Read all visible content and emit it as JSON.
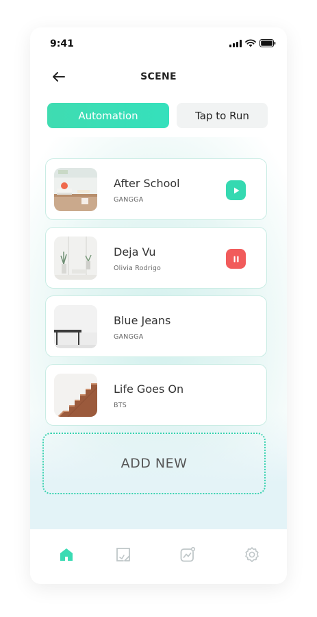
{
  "status_bar": {
    "time": "9:41"
  },
  "header": {
    "title": "SCENE"
  },
  "tabs": [
    {
      "label": "Automation",
      "active": true
    },
    {
      "label": "Tap to Run",
      "active": false
    }
  ],
  "scenes": [
    {
      "title": "After School",
      "subtitle": "GANGGA",
      "action": "play"
    },
    {
      "title": "Deja Vu",
      "subtitle": "Olivia Rodrigo",
      "action": "pause"
    },
    {
      "title": "Blue Jeans",
      "subtitle": "GANGGA",
      "action": "none"
    },
    {
      "title": "Life Goes On",
      "subtitle": "BTS",
      "action": "none"
    }
  ],
  "add_new": {
    "label": "ADD NEW"
  },
  "bottom_nav": [
    {
      "icon": "home-icon",
      "active": true
    },
    {
      "icon": "scene-icon",
      "active": false
    },
    {
      "icon": "stats-icon",
      "active": false
    },
    {
      "icon": "settings-icon",
      "active": false
    }
  ],
  "colors": {
    "accent": "#3ADBB3",
    "pause": "#F15B5B",
    "card_border": "#C9ECE4",
    "icon_inactive": "#BFC6C8"
  }
}
